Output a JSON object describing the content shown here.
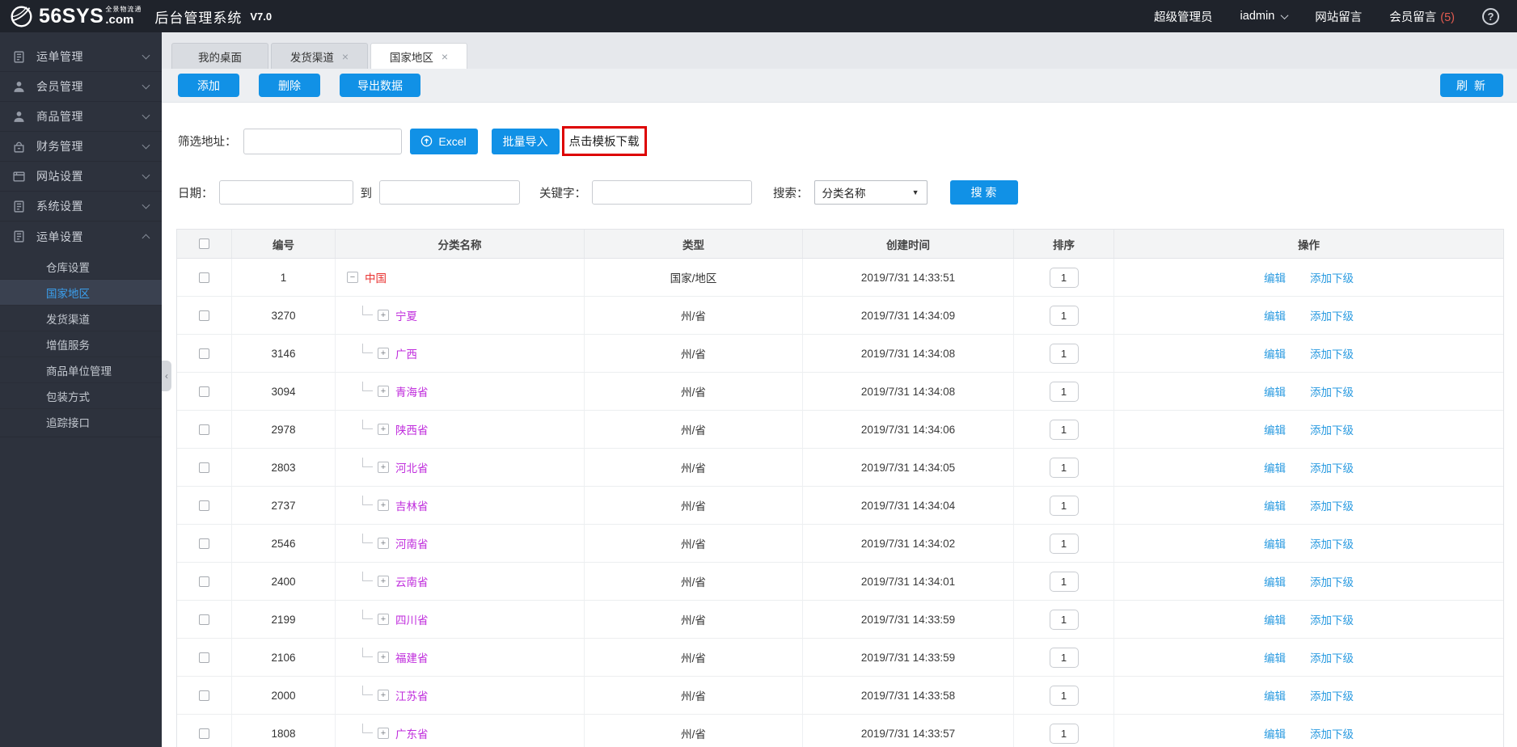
{
  "topbar": {
    "logo": {
      "brand": "56SYS",
      "tagline": "全景物流通",
      "tld": ".com",
      "system": "后台管理系统",
      "version": "V7.0"
    },
    "right": {
      "role": "超级管理员",
      "username": "iadmin",
      "site_messages": "网站留言",
      "member_messages": "会员留言",
      "member_count": "(5)",
      "help": "?"
    }
  },
  "sidebar": {
    "items": [
      {
        "label": "运单管理",
        "icon": "waybill-icon"
      },
      {
        "label": "会员管理",
        "icon": "member-icon"
      },
      {
        "label": "商品管理",
        "icon": "product-icon"
      },
      {
        "label": "财务管理",
        "icon": "finance-icon"
      },
      {
        "label": "网站设置",
        "icon": "website-icon"
      },
      {
        "label": "系统设置",
        "icon": "system-icon"
      },
      {
        "label": "运单设置",
        "icon": "waybill-settings-icon"
      }
    ],
    "subitems": [
      "仓库设置",
      "国家地区",
      "发货渠道",
      "增值服务",
      "商品单位管理",
      "包装方式",
      "追踪接口"
    ],
    "active_subitem": "国家地区"
  },
  "tabs": [
    {
      "label": "我的桌面",
      "closable": false,
      "active": false
    },
    {
      "label": "发货渠道",
      "closable": true,
      "active": false
    },
    {
      "label": "国家地区",
      "closable": true,
      "active": true
    }
  ],
  "toolbar": {
    "add": "添加",
    "delete": "删除",
    "export": "导出数据",
    "refresh": "刷 新"
  },
  "filters": {
    "address_label": "筛选地址：",
    "excel": "Excel",
    "batch_import": "批量导入",
    "template_hint": "点击模板下载",
    "date_label": "日期：",
    "to_label": "到",
    "keyword_label": "关键字：",
    "search_label": "搜索：",
    "search_select": "分类名称",
    "search_button": "搜 索"
  },
  "table": {
    "headers": [
      "编号",
      "分类名称",
      "类型",
      "创建时间",
      "排序",
      "操作"
    ],
    "edit_label": "编辑",
    "add_child_label": "添加下级",
    "rows": [
      {
        "id": "1",
        "name": "中国",
        "tree": "root",
        "type": "国家/地区",
        "created": "2019/7/31 14:33:51",
        "order": "1"
      },
      {
        "id": "3270",
        "name": "宁夏",
        "tree": "child",
        "type": "州/省",
        "created": "2019/7/31 14:34:09",
        "order": "1"
      },
      {
        "id": "3146",
        "name": "广西",
        "tree": "child",
        "type": "州/省",
        "created": "2019/7/31 14:34:08",
        "order": "1"
      },
      {
        "id": "3094",
        "name": "青海省",
        "tree": "child",
        "type": "州/省",
        "created": "2019/7/31 14:34:08",
        "order": "1"
      },
      {
        "id": "2978",
        "name": "陕西省",
        "tree": "child",
        "type": "州/省",
        "created": "2019/7/31 14:34:06",
        "order": "1"
      },
      {
        "id": "2803",
        "name": "河北省",
        "tree": "child",
        "type": "州/省",
        "created": "2019/7/31 14:34:05",
        "order": "1"
      },
      {
        "id": "2737",
        "name": "吉林省",
        "tree": "child",
        "type": "州/省",
        "created": "2019/7/31 14:34:04",
        "order": "1"
      },
      {
        "id": "2546",
        "name": "河南省",
        "tree": "child",
        "type": "州/省",
        "created": "2019/7/31 14:34:02",
        "order": "1"
      },
      {
        "id": "2400",
        "name": "云南省",
        "tree": "child",
        "type": "州/省",
        "created": "2019/7/31 14:34:01",
        "order": "1"
      },
      {
        "id": "2199",
        "name": "四川省",
        "tree": "child",
        "type": "州/省",
        "created": "2019/7/31 14:33:59",
        "order": "1"
      },
      {
        "id": "2106",
        "name": "福建省",
        "tree": "child",
        "type": "州/省",
        "created": "2019/7/31 14:33:59",
        "order": "1"
      },
      {
        "id": "2000",
        "name": "江苏省",
        "tree": "child",
        "type": "州/省",
        "created": "2019/7/31 14:33:58",
        "order": "1"
      },
      {
        "id": "1808",
        "name": "广东省",
        "tree": "child",
        "type": "州/省",
        "created": "2019/7/31 14:33:57",
        "order": "1"
      }
    ]
  },
  "ui": {
    "close_glyph": "×",
    "select_arrow": "▼",
    "collapse_glyph": "−",
    "expand_glyph": "+",
    "collapse_handle": "‹"
  },
  "colors": {
    "accent_blue": "#1191e6",
    "link_blue": "#2b9be0",
    "root_red": "#e8312f",
    "child_magenta": "#c02edd",
    "annotation_red": "#dd0000",
    "count_red": "#e25b50",
    "topbar_bg": "#1f232b",
    "sidebar_bg": "#2d323d"
  }
}
